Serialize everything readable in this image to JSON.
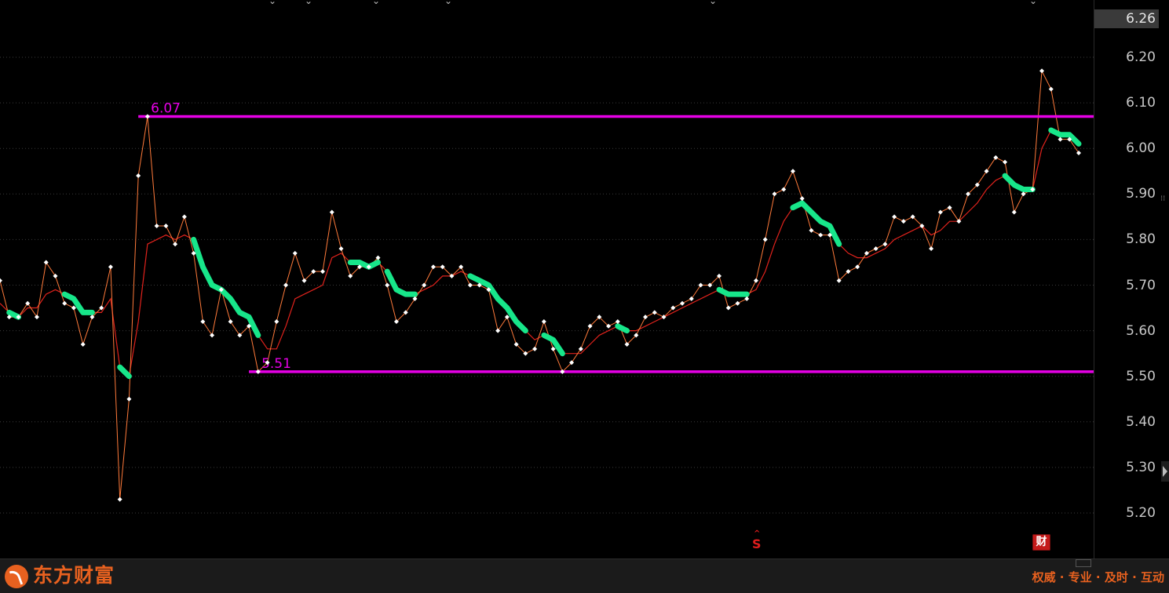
{
  "app": {
    "brand": "东方财富",
    "slogan": "权威 · 专业 · 及时 · 互动"
  },
  "price_axis": {
    "current_price": "6.26",
    "ticks": [
      "6.20",
      "6.10",
      "6.00",
      "5.90",
      "5.80",
      "5.70",
      "5.60",
      "5.50",
      "5.40",
      "5.30",
      "5.20"
    ]
  },
  "markers": {
    "cai_label": "财",
    "s_label": "S"
  },
  "colors": {
    "background": "#000000",
    "price_line": "#ffffff",
    "ma_line": "#e0221c",
    "support_resistance": "#e600e6",
    "highlight": "#17e68a",
    "brand": "#e8611f"
  },
  "chart_data": {
    "type": "line",
    "title": "",
    "xlabel": "",
    "ylabel": "",
    "ylim": [
      5.12,
      6.28
    ],
    "grid": true,
    "resistance": {
      "value": 6.07,
      "label": "6.07",
      "start_index": 15
    },
    "support": {
      "value": 5.51,
      "label": "5.51",
      "start_index": 27
    },
    "series": [
      {
        "name": "",
        "style": "price",
        "values": [
          5.71,
          5.63,
          5.63,
          5.66,
          5.63,
          5.75,
          5.72,
          5.66,
          5.65,
          5.57,
          5.63,
          5.65,
          5.74,
          5.23,
          5.45,
          5.94,
          6.07,
          5.83,
          5.83,
          5.79,
          5.85,
          5.77,
          5.62,
          5.59,
          5.69,
          5.62,
          5.59,
          5.61,
          5.51,
          5.53,
          5.62,
          5.7,
          5.77,
          5.71,
          5.73,
          5.73,
          5.86,
          5.78,
          5.72,
          5.74,
          5.74,
          5.76,
          5.7,
          5.62,
          5.64,
          5.67,
          5.7,
          5.74,
          5.74,
          5.72,
          5.74,
          5.7,
          5.7,
          5.69,
          5.6,
          5.63,
          5.57,
          5.55,
          5.56,
          5.62,
          5.56,
          5.51,
          5.53,
          5.56,
          5.61,
          5.63,
          5.61,
          5.62,
          5.57,
          5.59,
          5.63,
          5.64,
          5.63,
          5.65,
          5.66,
          5.67,
          5.7,
          5.7,
          5.72,
          5.65,
          5.66,
          5.67,
          5.71,
          5.8,
          5.9,
          5.91,
          5.95,
          5.89,
          5.82,
          5.81,
          5.81,
          5.71,
          5.73,
          5.74,
          5.77,
          5.78,
          5.79,
          5.85,
          5.84,
          5.85,
          5.83,
          5.78,
          5.86,
          5.87,
          5.84,
          5.9,
          5.92,
          5.95,
          5.98,
          5.97,
          5.86,
          5.9,
          5.91,
          6.17,
          6.13,
          6.02,
          6.02,
          5.99
        ]
      },
      {
        "name": "",
        "style": "ma",
        "values": [
          5.66,
          5.64,
          5.63,
          5.65,
          5.65,
          5.68,
          5.69,
          5.68,
          5.67,
          5.64,
          5.64,
          5.64,
          5.67,
          5.52,
          5.5,
          5.62,
          5.79,
          5.8,
          5.81,
          5.8,
          5.81,
          5.8,
          5.74,
          5.7,
          5.69,
          5.67,
          5.64,
          5.63,
          5.59,
          5.56,
          5.56,
          5.61,
          5.67,
          5.68,
          5.69,
          5.7,
          5.76,
          5.77,
          5.75,
          5.75,
          5.74,
          5.75,
          5.73,
          5.69,
          5.68,
          5.68,
          5.69,
          5.7,
          5.72,
          5.72,
          5.73,
          5.72,
          5.71,
          5.7,
          5.67,
          5.65,
          5.62,
          5.6,
          5.58,
          5.59,
          5.58,
          5.55,
          5.55,
          5.55,
          5.57,
          5.59,
          5.6,
          5.61,
          5.6,
          5.6,
          5.61,
          5.62,
          5.63,
          5.64,
          5.65,
          5.66,
          5.67,
          5.68,
          5.69,
          5.68,
          5.68,
          5.68,
          5.69,
          5.73,
          5.79,
          5.84,
          5.87,
          5.88,
          5.86,
          5.84,
          5.83,
          5.79,
          5.77,
          5.76,
          5.76,
          5.77,
          5.78,
          5.8,
          5.81,
          5.82,
          5.83,
          5.81,
          5.82,
          5.84,
          5.84,
          5.86,
          5.88,
          5.91,
          5.93,
          5.94,
          5.92,
          5.91,
          5.91,
          6.0,
          6.04,
          6.03,
          6.03,
          6.01
        ]
      }
    ],
    "highlight_segments": [
      [
        1,
        2
      ],
      [
        7,
        10
      ],
      [
        13,
        14
      ],
      [
        21,
        28
      ],
      [
        38,
        41
      ],
      [
        42,
        45
      ],
      [
        51,
        57
      ],
      [
        59,
        61
      ],
      [
        67,
        68
      ],
      [
        78,
        81
      ],
      [
        86,
        91
      ],
      [
        109,
        112
      ],
      [
        114,
        117
      ]
    ]
  }
}
